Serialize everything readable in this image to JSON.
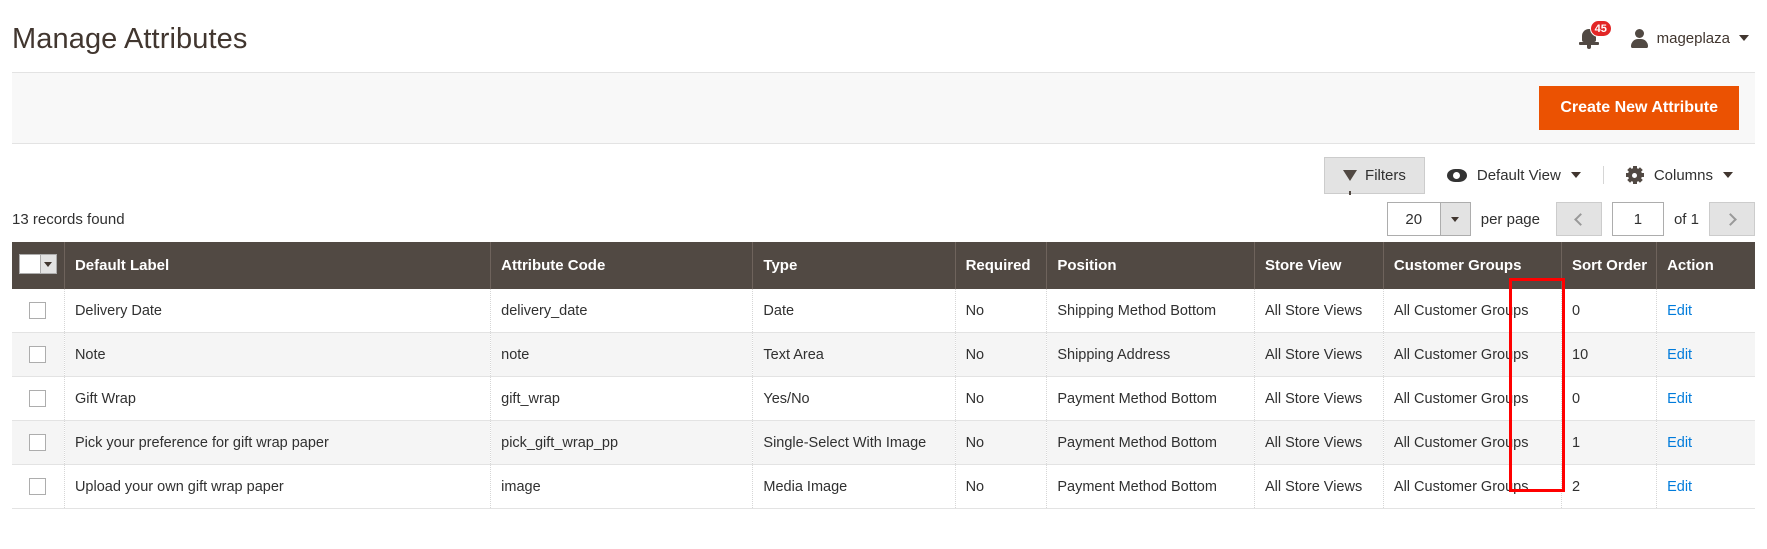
{
  "header": {
    "title": "Manage Attributes",
    "notifications": {
      "icon": "bell-icon",
      "count": "45"
    },
    "user": {
      "icon": "user-avatar-icon",
      "name": "mageplaza",
      "caret": "chevron-down-icon"
    }
  },
  "action_bar": {
    "create_button": "Create New Attribute",
    "accent_color": "#eb5202"
  },
  "toolbar": {
    "filters_label": "Filters",
    "filters_icon": "funnel-icon",
    "view_icon": "eye-icon",
    "view_label": "Default View",
    "columns_icon": "gear-icon",
    "columns_label": "Columns"
  },
  "grid_meta": {
    "records_found": "13 records found",
    "per_page_value": "20",
    "per_page_label": "per page",
    "prev_label": "‹",
    "page_value": "1",
    "of_label": "of 1",
    "next_label": "›"
  },
  "table": {
    "columns": [
      "Default Label",
      "Attribute Code",
      "Type",
      "Required",
      "Position",
      "Store View",
      "Customer Groups",
      "Sort Order",
      "Action"
    ],
    "rows": [
      {
        "default_label": "Delivery Date",
        "attribute_code": "delivery_date",
        "type": "Date",
        "required": "No",
        "position": "Shipping Method Bottom",
        "store_view": "All Store Views",
        "customer_groups": "All Customer Groups",
        "sort_order": "0",
        "action": "Edit"
      },
      {
        "default_label": "Note",
        "attribute_code": "note",
        "type": "Text Area",
        "required": "No",
        "position": "Shipping Address",
        "store_view": "All Store Views",
        "customer_groups": "All Customer Groups",
        "sort_order": "10",
        "action": "Edit"
      },
      {
        "default_label": "Gift Wrap",
        "attribute_code": "gift_wrap",
        "type": "Yes/No",
        "required": "No",
        "position": "Payment Method Bottom",
        "store_view": "All Store Views",
        "customer_groups": "All Customer Groups",
        "sort_order": "0",
        "action": "Edit"
      },
      {
        "default_label": "Pick your preference for gift wrap paper",
        "attribute_code": "pick_gift_wrap_pp",
        "type": "Single-Select With Image",
        "required": "No",
        "position": "Payment Method Bottom",
        "store_view": "All Store Views",
        "customer_groups": "All Customer Groups",
        "sort_order": "1",
        "action": "Edit"
      },
      {
        "default_label": "Upload your own gift wrap paper",
        "attribute_code": "image",
        "type": "Media Image",
        "required": "No",
        "position": "Payment Method Bottom",
        "store_view": "All Store Views",
        "customer_groups": "All Customer Groups",
        "sort_order": "2",
        "action": "Edit"
      }
    ]
  },
  "annotation": {
    "color": "#ff0000",
    "target": "action-column"
  }
}
